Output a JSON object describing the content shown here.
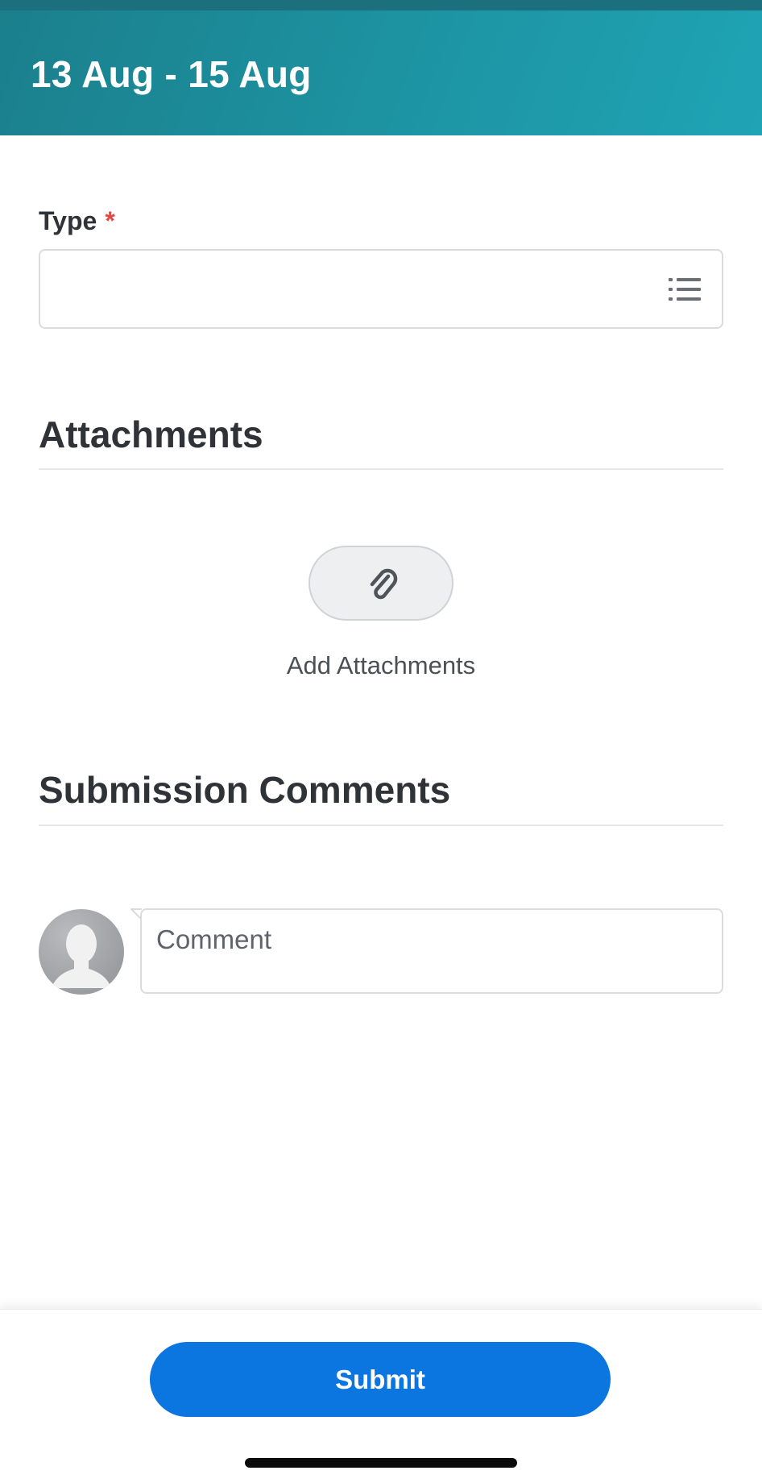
{
  "header": {
    "title": "13 Aug - 15 Aug"
  },
  "form": {
    "type_label": "Type",
    "required_marker": "*",
    "type_value": "",
    "type_icon": "list-icon"
  },
  "attachments": {
    "section_title": "Attachments",
    "button_icon": "paperclip-icon",
    "add_label": "Add Attachments"
  },
  "comments": {
    "section_title": "Submission Comments",
    "avatar_icon": "avatar-placeholder-icon",
    "placeholder": "Comment"
  },
  "footer": {
    "submit_label": "Submit"
  },
  "colors": {
    "header_start": "#1b7f8c",
    "header_end": "#1fa4b5",
    "required": "#e9463f",
    "primary_button": "#0b75e0"
  }
}
